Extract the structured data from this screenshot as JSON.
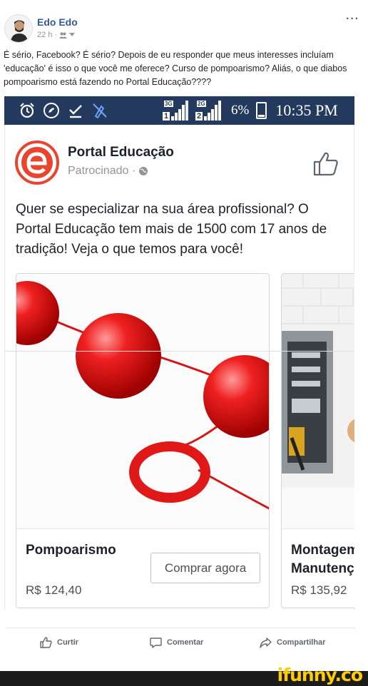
{
  "post": {
    "author": "Edo Edo",
    "time": "22 h ·",
    "more": "···",
    "text": "É sério, Facebook? É sério? Depois de eu responder que meus interesses incluíam 'educação' é isso o que você me oferece? Curso de pompoarismo? Aliás, o que diabos pompoarismo está fazendo no Portal Educação????"
  },
  "statusbar": {
    "net1": "3G",
    "sim1": "1",
    "net2": "2G",
    "sim2": "2",
    "battery": "6%",
    "time": "10:35 PM"
  },
  "ad": {
    "page_name": "Portal Educação",
    "sponsored": "Patrocinado ·",
    "body": "Quer se especializar na sua área profissional? O Portal Educação tem mais de 1500 com 17 anos de tradição! Veja o que temos para você!",
    "cards": [
      {
        "title": "Pompoarismo",
        "price": "R$ 124,40",
        "button": "Comprar agora"
      },
      {
        "title": "Montagem e Manutenção",
        "price": "R$ 135,92"
      }
    ]
  },
  "actions": {
    "like": "Curtir",
    "comment": "Comentar",
    "share": "Compartilhar"
  },
  "watermark": "ifunny.co",
  "colors": {
    "statusbar": "#233a5e",
    "link": "#365899",
    "brand_red": "#e8442e",
    "watermark": "#ffcc00"
  }
}
